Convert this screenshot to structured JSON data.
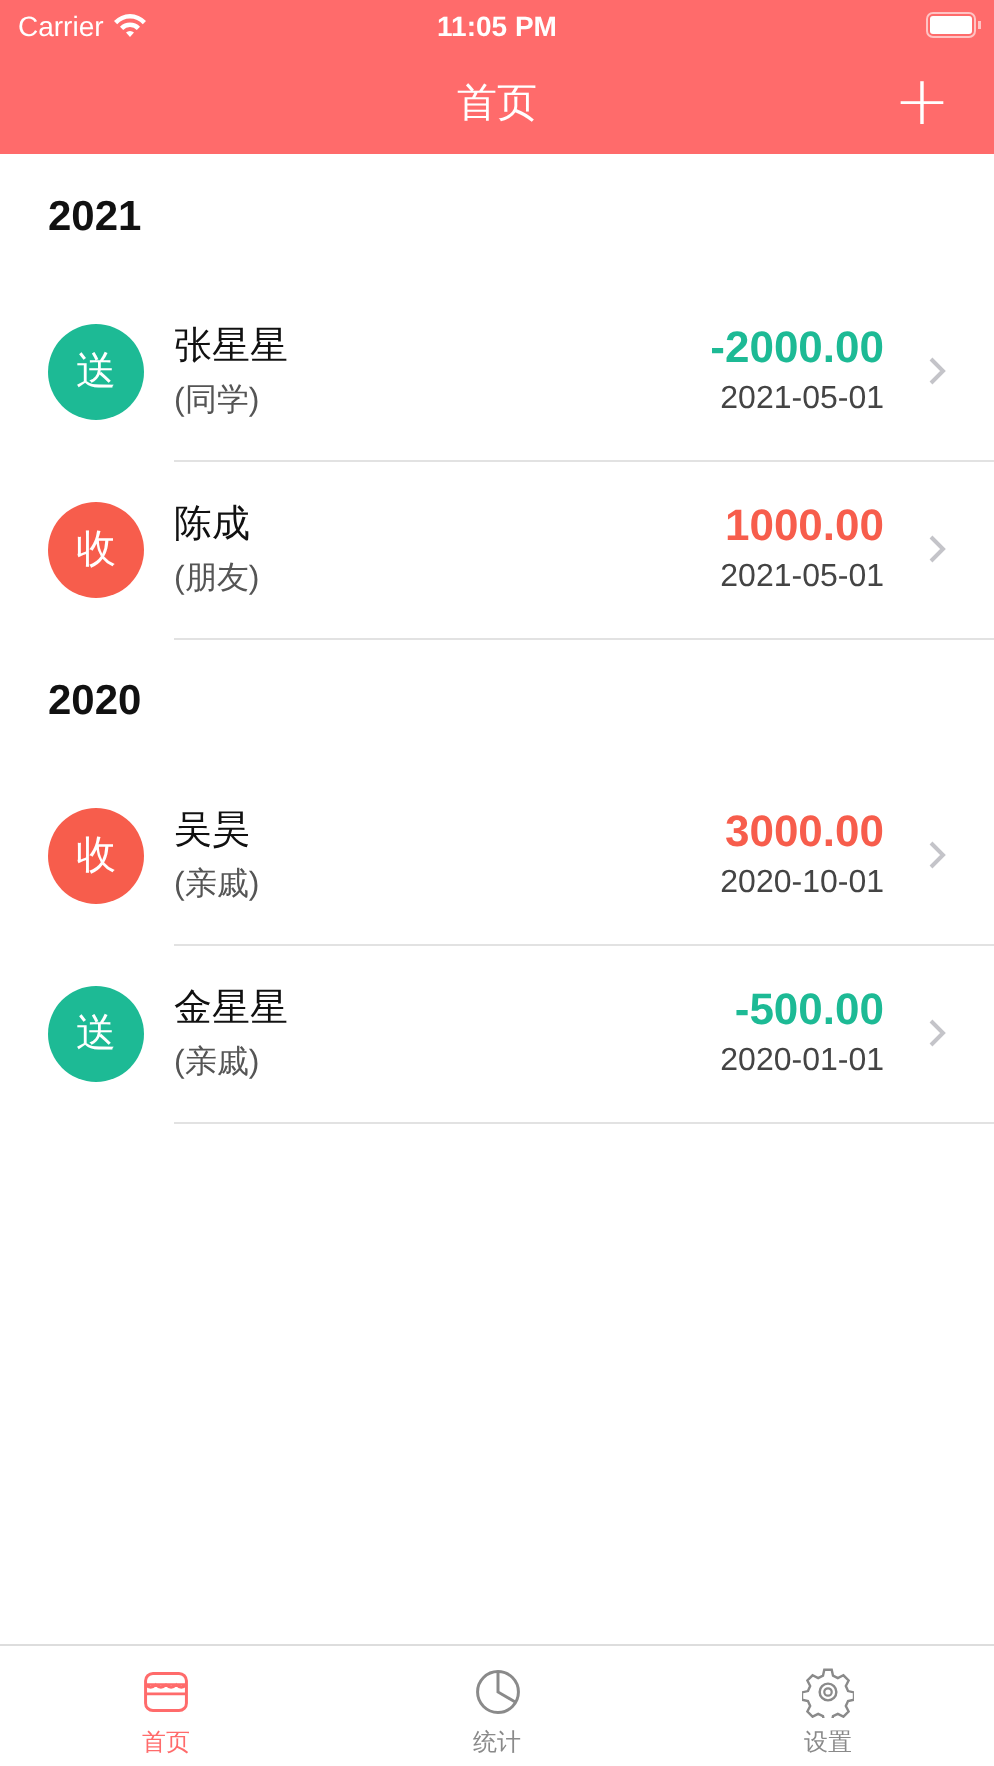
{
  "status_bar": {
    "carrier": "Carrier",
    "time": "11:05 PM"
  },
  "nav": {
    "title": "首页",
    "action": "+"
  },
  "sections": [
    {
      "year": "2021",
      "records": [
        {
          "kind": "send",
          "badge": "送",
          "name": "张星星",
          "relation": "(同学)",
          "amount": "-2000.00",
          "date": "2021-05-01"
        },
        {
          "kind": "receive",
          "badge": "收",
          "name": "陈成",
          "relation": "(朋友)",
          "amount": "1000.00",
          "date": "2021-05-01"
        }
      ]
    },
    {
      "year": "2020",
      "records": [
        {
          "kind": "receive",
          "badge": "收",
          "name": "吴昊",
          "relation": "(亲戚)",
          "amount": "3000.00",
          "date": "2020-10-01"
        },
        {
          "kind": "send",
          "badge": "送",
          "name": "金星星",
          "relation": "(亲戚)",
          "amount": "-500.00",
          "date": "2020-01-01"
        }
      ]
    }
  ],
  "tabs": [
    {
      "kind": "home",
      "label": "首页",
      "selected": true
    },
    {
      "kind": "stats",
      "label": "统计",
      "selected": false
    },
    {
      "kind": "settings",
      "label": "设置",
      "selected": false
    }
  ]
}
